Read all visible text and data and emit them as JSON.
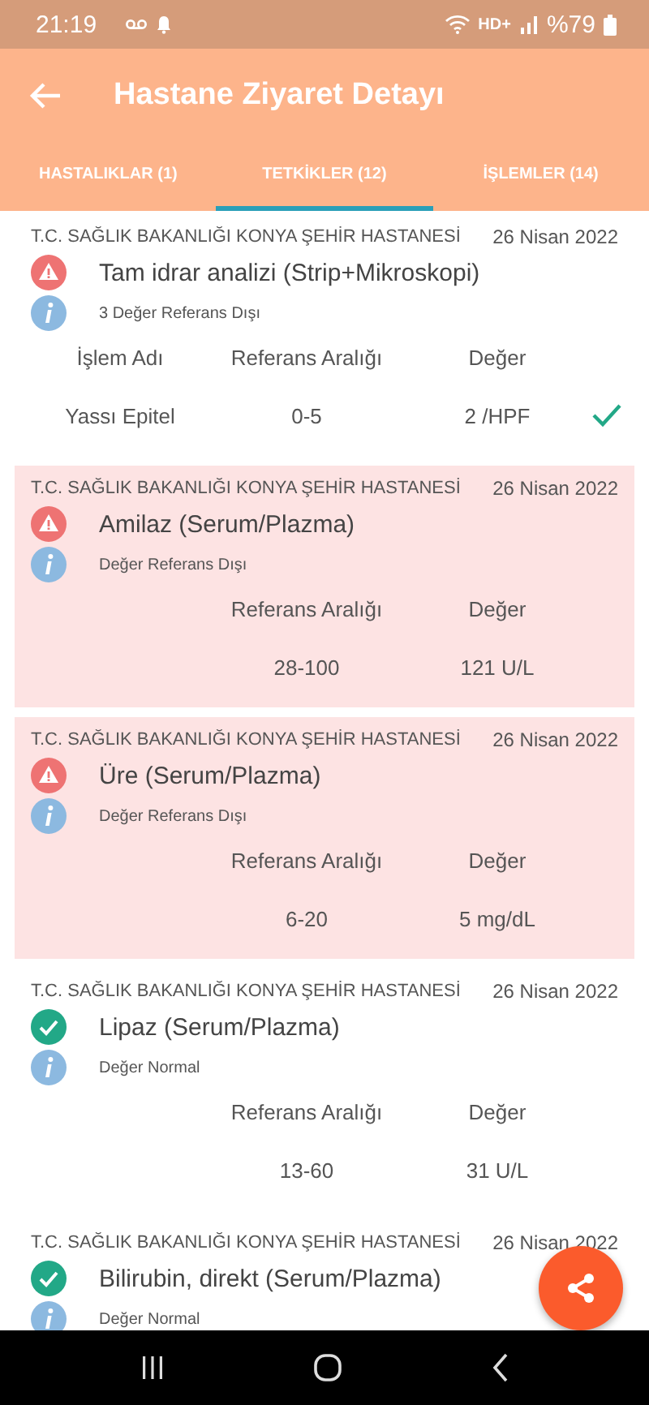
{
  "status_bar": {
    "time": "21:19",
    "network": "HD+",
    "battery": "%79"
  },
  "app_bar": {
    "title": "Hastane Ziyaret Detayı"
  },
  "tabs": [
    {
      "label": "HASTALIKLAR (1)",
      "selected": false
    },
    {
      "label": "TETKİKLER (12)",
      "selected": true
    },
    {
      "label": "İŞLEMLER (14)",
      "selected": false
    }
  ],
  "results": [
    {
      "hospital": "T.C. SAĞLIK BAKANLIĞI KONYA ŞEHİR HASTANESİ",
      "date": "26 Nisan 2022",
      "kind": "warning",
      "highlighted": false,
      "name": "Tam idrar analizi (Strip+Mikroskopi)",
      "note": "3 Değer Referans Dışı",
      "header": {
        "name": "İşlem Adı",
        "range": "Referans Aralığı",
        "value": "Değer"
      },
      "rows": [
        {
          "name": "Yassı Epitel",
          "range": "0-5",
          "value": "2 /HPF",
          "checked": true
        }
      ]
    },
    {
      "hospital": "T.C. SAĞLIK BAKANLIĞI KONYA ŞEHİR HASTANESİ",
      "date": "26 Nisan 2022",
      "kind": "warning",
      "highlighted": true,
      "name": "Amilaz (Serum/Plazma)",
      "note": "Değer Referans Dışı",
      "header": {
        "range": "Referans Aralığı",
        "value": "Değer"
      },
      "rows": [
        {
          "range": "28-100",
          "value": "121 U/L",
          "checked": false
        }
      ]
    },
    {
      "hospital": "T.C. SAĞLIK BAKANLIĞI KONYA ŞEHİR HASTANESİ",
      "date": "26 Nisan 2022",
      "kind": "warning",
      "highlighted": true,
      "name": "Üre (Serum/Plazma)",
      "note": "Değer Referans Dışı",
      "header": {
        "range": "Referans Aralığı",
        "value": "Değer"
      },
      "rows": [
        {
          "range": "6-20",
          "value": "5 mg/dL",
          "checked": false
        }
      ]
    },
    {
      "hospital": "T.C. SAĞLIK BAKANLIĞI KONYA ŞEHİR HASTANESİ",
      "date": "26 Nisan 2022",
      "kind": "normal",
      "highlighted": false,
      "name": "Lipaz (Serum/Plazma)",
      "note": "Değer Normal",
      "header": {
        "range": "Referans Aralığı",
        "value": "Değer"
      },
      "rows": [
        {
          "range": "13-60",
          "value": "31 U/L",
          "checked": false
        }
      ]
    },
    {
      "hospital": "T.C. SAĞLIK BAKANLIĞI KONYA ŞEHİR HASTANESİ",
      "date": "26 Nisan 2022",
      "kind": "normal",
      "highlighted": false,
      "name": "Bilirubin, direkt (Serum/Plazma)",
      "note": "Değer Normal"
    }
  ]
}
